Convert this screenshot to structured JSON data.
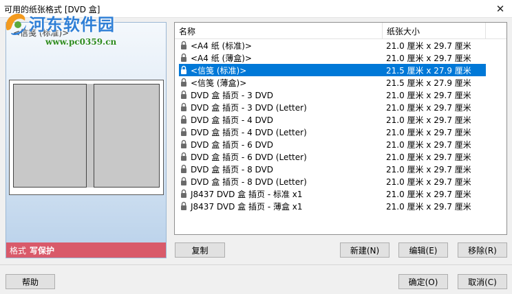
{
  "window": {
    "title": "可用的纸张格式 [DVD 盒]",
    "close_glyph": "✕"
  },
  "watermark": {
    "title": "河东软件园",
    "url": "www.pc0359.cn"
  },
  "preview": {
    "selected_name": "<信笺 (标准)>",
    "status_label": "格式",
    "status_value": "写保护",
    "status_color": "#d95a6a"
  },
  "list": {
    "columns": [
      "名称",
      "纸张大小"
    ],
    "selected_color": "#0078d7",
    "rows": [
      {
        "name": "<A4 纸 (标准)>",
        "size": "21.0 厘米 x 29.7 厘米"
      },
      {
        "name": "<A4 纸 (薄盒)>",
        "size": "21.0 厘米 x 29.7 厘米"
      },
      {
        "name": "<信笺 (标准)>",
        "size": "21.5 厘米 x 27.9 厘米"
      },
      {
        "name": "<信笺 (薄盒)>",
        "size": "21.5 厘米 x 27.9 厘米"
      },
      {
        "name": "DVD 盒 插页 - 3 DVD",
        "size": "21.0 厘米 x 29.7 厘米"
      },
      {
        "name": "DVD 盒 插页 - 3 DVD (Letter)",
        "size": "21.0 厘米 x 29.7 厘米"
      },
      {
        "name": "DVD 盒 插页 - 4 DVD",
        "size": "21.0 厘米 x 29.7 厘米"
      },
      {
        "name": "DVD 盒 插页 - 4 DVD (Letter)",
        "size": "21.0 厘米 x 29.7 厘米"
      },
      {
        "name": "DVD 盒 插页 - 6 DVD",
        "size": "21.0 厘米 x 29.7 厘米"
      },
      {
        "name": "DVD 盒 插页 - 6 DVD (Letter)",
        "size": "21.0 厘米 x 29.7 厘米"
      },
      {
        "name": "DVD 盒 插页 - 8 DVD",
        "size": "21.0 厘米 x 29.7 厘米"
      },
      {
        "name": "DVD 盒 插页 - 8 DVD (Letter)",
        "size": "21.0 厘米 x 29.7 厘米"
      },
      {
        "name": "J8437 DVD 盒 插页 - 标准 x1",
        "size": "21.0 厘米 x 29.7 厘米"
      },
      {
        "name": "J8437 DVD 盒 插页 - 薄盒 x1",
        "size": "21.0 厘米 x 29.7 厘米"
      }
    ],
    "selected_index": 2
  },
  "buttons": {
    "copy": "复制",
    "new": "新建(N)",
    "edit": "编辑(E)",
    "remove": "移除(R)",
    "help": "帮助",
    "ok": "确定(O)",
    "cancel": "取消(C)"
  }
}
